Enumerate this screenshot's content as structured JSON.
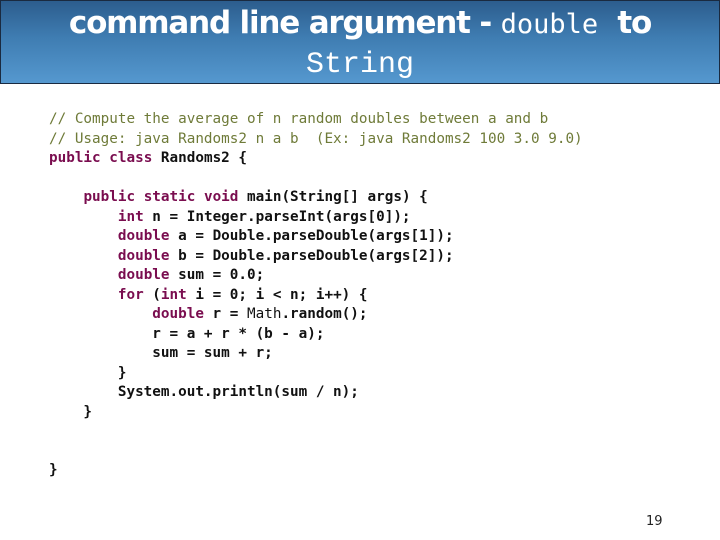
{
  "header": {
    "title_part1": "command line argument - ",
    "title_code1": "double",
    "title_part2": "  to",
    "title_code2": "String",
    "colors": {
      "gradient_top": "#2c5d8d",
      "gradient_bottom": "#5598cf",
      "text": "#ffffff"
    }
  },
  "code": {
    "colors": {
      "comment": "#6f7b39",
      "keyword": "#7a0d4f",
      "plain": "#111111"
    },
    "lines": [
      {
        "tokens": [
          {
            "t": "cm",
            "v": "// Compute the average of n random doubles between a and b"
          }
        ]
      },
      {
        "tokens": [
          {
            "t": "cm",
            "v": "// Usage: java Randoms2 n a b  (Ex: java Randoms2 100 3.0 9.0)"
          }
        ]
      },
      {
        "tokens": [
          {
            "t": "kw",
            "v": "public"
          },
          {
            "t": "pl",
            "v": " "
          },
          {
            "t": "kw",
            "v": "class"
          },
          {
            "t": "pl",
            "v": " Randoms2 {"
          }
        ]
      },
      {
        "tokens": []
      },
      {
        "tokens": [
          {
            "t": "pl",
            "v": "    "
          },
          {
            "t": "kw",
            "v": "public"
          },
          {
            "t": "pl",
            "v": " "
          },
          {
            "t": "kw",
            "v": "static"
          },
          {
            "t": "pl",
            "v": " "
          },
          {
            "t": "kw",
            "v": "void"
          },
          {
            "t": "pl",
            "v": " main(String[] args) {"
          }
        ]
      },
      {
        "tokens": [
          {
            "t": "pl",
            "v": "        "
          },
          {
            "t": "kw",
            "v": "int"
          },
          {
            "t": "pl",
            "v": " n = Integer.parseInt(args[0]);"
          }
        ]
      },
      {
        "tokens": [
          {
            "t": "pl",
            "v": "        "
          },
          {
            "t": "kw",
            "v": "double"
          },
          {
            "t": "pl",
            "v": " a = Double.parseDouble(args[1]);"
          }
        ]
      },
      {
        "tokens": [
          {
            "t": "pl",
            "v": "        "
          },
          {
            "t": "kw",
            "v": "double"
          },
          {
            "t": "pl",
            "v": " b = Double.parseDouble(args[2]);"
          }
        ]
      },
      {
        "tokens": [
          {
            "t": "pl",
            "v": "        "
          },
          {
            "t": "kw",
            "v": "double"
          },
          {
            "t": "pl",
            "v": " sum = 0.0;"
          }
        ]
      },
      {
        "tokens": [
          {
            "t": "pl",
            "v": "        "
          },
          {
            "t": "kw",
            "v": "for"
          },
          {
            "t": "pl",
            "v": " ("
          },
          {
            "t": "kw",
            "v": "int"
          },
          {
            "t": "pl",
            "v": " i = 0; i < n; i++) {"
          }
        ]
      },
      {
        "tokens": [
          {
            "t": "pl",
            "v": "            "
          },
          {
            "t": "kw",
            "v": "double"
          },
          {
            "t": "pl",
            "v": " r = "
          },
          {
            "t": "nb",
            "v": "Math"
          },
          {
            "t": "pl",
            "v": ".random();"
          }
        ]
      },
      {
        "tokens": [
          {
            "t": "pl",
            "v": "            r = a + r * (b - a);"
          }
        ]
      },
      {
        "tokens": [
          {
            "t": "pl",
            "v": "            sum = sum + r;"
          }
        ]
      },
      {
        "tokens": [
          {
            "t": "pl",
            "v": "        }"
          }
        ]
      },
      {
        "tokens": [
          {
            "t": "pl",
            "v": "        System.out.println(sum / n);"
          }
        ]
      },
      {
        "tokens": [
          {
            "t": "pl",
            "v": "    }"
          }
        ]
      },
      {
        "tokens": []
      },
      {
        "tokens": []
      },
      {
        "tokens": [
          {
            "t": "pl",
            "v": "}"
          }
        ]
      }
    ]
  },
  "footer": {
    "page_number": "19"
  }
}
